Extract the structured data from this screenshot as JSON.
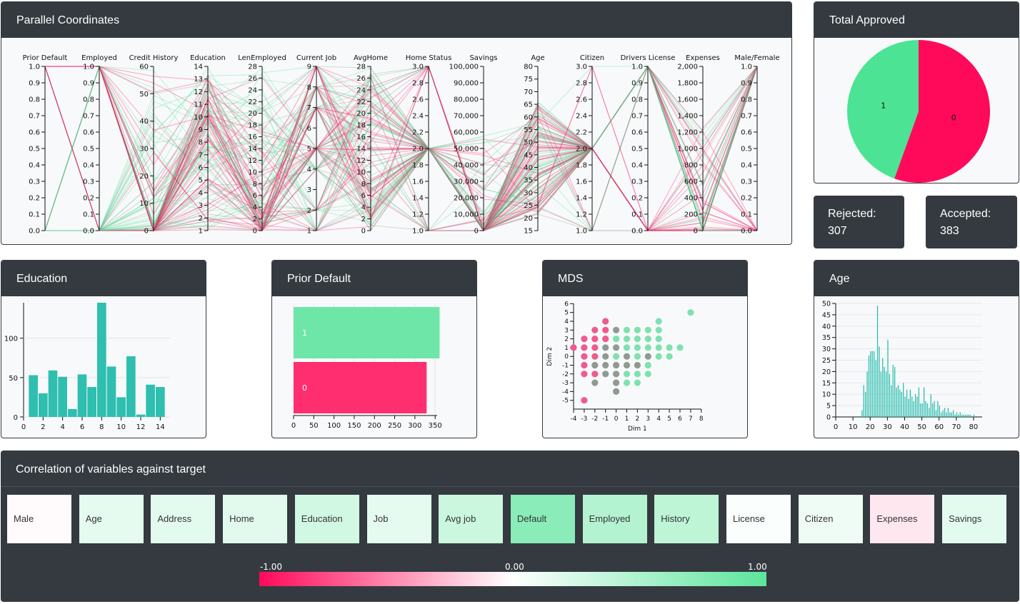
{
  "panels": {
    "parallel": "Parallel Coordinates",
    "approved": "Total Approved",
    "education": "Education",
    "prior_default": "Prior Default",
    "mds": "MDS",
    "age": "Age",
    "correlation": "Correlation of variables against target"
  },
  "stats": {
    "rejected_label": "Rejected:",
    "rejected_value": "307",
    "accepted_label": "Accepted:",
    "accepted_value": "383"
  },
  "colors": {
    "accepted": "#4ce394",
    "rejected": "#ff0a5a",
    "hist": "#2ebfb0",
    "dark": "#343a40"
  },
  "parallel_axes": [
    {
      "name": "Prior Default",
      "ticks": [
        "1.0",
        "0.9",
        "0.8",
        "0.7",
        "0.6",
        "0.5",
        "0.4",
        "0.3",
        "0.2",
        "0.1",
        "0.0"
      ]
    },
    {
      "name": "Employed",
      "ticks": [
        "1.0",
        "0.9",
        "0.8",
        "0.7",
        "0.6",
        "0.5",
        "0.4",
        "0.3",
        "0.2",
        "0.1",
        "0.0"
      ]
    },
    {
      "name": "Credit History",
      "ticks": [
        "60",
        "50",
        "40",
        "30",
        "20",
        "10",
        "0"
      ]
    },
    {
      "name": "Education",
      "ticks": [
        "14",
        "13",
        "12",
        "11",
        "10",
        "9",
        "8",
        "7",
        "6",
        "5",
        "4",
        "3",
        "2",
        "1"
      ]
    },
    {
      "name": "LenEmployed",
      "ticks": [
        "28",
        "26",
        "24",
        "22",
        "20",
        "18",
        "16",
        "14",
        "12",
        "10",
        "8",
        "6",
        "4",
        "2",
        "0"
      ]
    },
    {
      "name": "Current Job",
      "ticks": [
        "9",
        "8",
        "7",
        "6",
        "5",
        "4",
        "3",
        "2",
        "1"
      ]
    },
    {
      "name": "AvgHome",
      "ticks": [
        "28",
        "26",
        "24",
        "22",
        "20",
        "18",
        "16",
        "14",
        "12",
        "10",
        "8",
        "6",
        "4",
        "2",
        "0"
      ]
    },
    {
      "name": "Home Status",
      "ticks": [
        "3.0",
        "2.8",
        "2.6",
        "2.4",
        "2.2",
        "2.0",
        "1.8",
        "1.6",
        "1.4",
        "1.2",
        "1.0"
      ]
    },
    {
      "name": "Savings",
      "ticks": [
        "100,000",
        "90,000",
        "80,000",
        "70,000",
        "60,000",
        "50,000",
        "40,000",
        "30,000",
        "20,000",
        "10,000",
        "0"
      ]
    },
    {
      "name": "Age",
      "ticks": [
        "80",
        "75",
        "70",
        "65",
        "60",
        "55",
        "50",
        "45",
        "40",
        "35",
        "30",
        "25",
        "20",
        "15"
      ]
    },
    {
      "name": "Citizen",
      "ticks": [
        "3.0",
        "2.8",
        "2.6",
        "2.4",
        "2.2",
        "2.0",
        "1.8",
        "1.6",
        "1.4",
        "1.2",
        "1.0"
      ]
    },
    {
      "name": "Drivers License",
      "ticks": [
        "1.0",
        "0.9",
        "0.8",
        "0.7",
        "0.6",
        "0.5",
        "0.4",
        "0.3",
        "0.2",
        "0.1",
        "0.0"
      ]
    },
    {
      "name": "Expenses",
      "ticks": [
        "2,000",
        "1,800",
        "1,600",
        "1,400",
        "1,200",
        "1,000",
        "800",
        "600",
        "400",
        "200",
        "0"
      ]
    },
    {
      "name": "Male/Female",
      "ticks": [
        "1.0",
        "0.9",
        "0.8",
        "0.7",
        "0.6",
        "0.5",
        "0.4",
        "0.3",
        "0.2",
        "0.1",
        "0.0"
      ]
    }
  ],
  "correlation": {
    "cells": [
      {
        "label": "Male",
        "value": -0.02
      },
      {
        "label": "Age",
        "value": 0.16
      },
      {
        "label": "Address",
        "value": 0.17
      },
      {
        "label": "Home",
        "value": 0.18
      },
      {
        "label": "Education",
        "value": 0.28
      },
      {
        "label": "Job",
        "value": 0.16
      },
      {
        "label": "Avg job",
        "value": 0.32
      },
      {
        "label": "Default",
        "value": 0.72
      },
      {
        "label": "Employed",
        "value": 0.46
      },
      {
        "label": "History",
        "value": 0.4
      },
      {
        "label": "License",
        "value": 0.03
      },
      {
        "label": "Citizen",
        "value": 0.1
      },
      {
        "label": "Expenses",
        "value": -0.1
      },
      {
        "label": "Savings",
        "value": 0.17
      }
    ],
    "legend_min": "-1.00",
    "legend_mid": "0.00",
    "legend_max": "1.00"
  },
  "chart_data": [
    {
      "type": "pie",
      "title": "Total Approved",
      "slices": [
        {
          "label": "0",
          "value": 383,
          "color": "#ff0a5a"
        },
        {
          "label": "1",
          "value": 307,
          "color": "#4ce394"
        }
      ]
    },
    {
      "type": "bar",
      "title": "Education",
      "x": [
        1,
        2,
        3,
        4,
        5,
        6,
        7,
        8,
        9,
        10,
        11,
        12,
        13,
        14
      ],
      "values": [
        53,
        30,
        59,
        51,
        10,
        54,
        38,
        145,
        64,
        25,
        77,
        3,
        41,
        38
      ],
      "xticks": [
        "0",
        "2",
        "4",
        "6",
        "8",
        "10",
        "12",
        "14"
      ],
      "yticks": [
        "0",
        "50",
        "100"
      ],
      "xlim": [
        0,
        15
      ],
      "ylim": [
        0,
        145
      ]
    },
    {
      "type": "bar",
      "orientation": "horizontal",
      "title": "Prior Default",
      "categories": [
        "1",
        "0"
      ],
      "values": [
        361,
        329
      ],
      "xticks": [
        "0",
        "50",
        "100",
        "150",
        "200",
        "250",
        "300",
        "350"
      ],
      "xlim": [
        0,
        355
      ]
    },
    {
      "type": "scatter",
      "title": "MDS",
      "xlabel": "Dim 1",
      "ylabel": "Dim 2",
      "xticks": [
        "-4",
        "-3",
        "-2",
        "-1",
        "0",
        "1",
        "2",
        "3",
        "4",
        "5",
        "6",
        "7",
        "8"
      ],
      "yticks": [
        "-5",
        "-4",
        "-3",
        "-2",
        "-1",
        "0",
        "1",
        "2",
        "3",
        "4",
        "5",
        "6"
      ],
      "xlim": [
        -4,
        8
      ],
      "ylim": [
        -6,
        6
      ],
      "points": [
        {
          "x": -4,
          "y": 1,
          "c": "r"
        },
        {
          "x": -3,
          "y": -5,
          "c": "r"
        },
        {
          "x": -3,
          "y": 2,
          "c": "r"
        },
        {
          "x": -3,
          "y": 1,
          "c": "r"
        },
        {
          "x": -3,
          "y": 0,
          "c": "r"
        },
        {
          "x": -3,
          "y": -1,
          "c": "r"
        },
        {
          "x": -3,
          "y": -2,
          "c": "r"
        },
        {
          "x": -2,
          "y": 3,
          "c": "r"
        },
        {
          "x": -2,
          "y": 2,
          "c": "r"
        },
        {
          "x": -2,
          "y": 1,
          "c": "r"
        },
        {
          "x": -2,
          "y": 0,
          "c": "r"
        },
        {
          "x": -2,
          "y": -1,
          "c": "g"
        },
        {
          "x": -2,
          "y": -2,
          "c": "r"
        },
        {
          "x": -2,
          "y": -3,
          "c": "g"
        },
        {
          "x": -1,
          "y": 4,
          "c": "r"
        },
        {
          "x": -1,
          "y": 3,
          "c": "r"
        },
        {
          "x": -1,
          "y": 2,
          "c": "r"
        },
        {
          "x": -1,
          "y": 1,
          "c": "g"
        },
        {
          "x": -1,
          "y": 0,
          "c": "g"
        },
        {
          "x": -1,
          "y": -1,
          "c": "g"
        },
        {
          "x": -1,
          "y": -2,
          "c": "g"
        },
        {
          "x": 0,
          "y": 3,
          "c": "g"
        },
        {
          "x": 0,
          "y": 2,
          "c": "a"
        },
        {
          "x": 0,
          "y": 1,
          "c": "g"
        },
        {
          "x": 0,
          "y": 0,
          "c": "a"
        },
        {
          "x": 0,
          "y": -1,
          "c": "g"
        },
        {
          "x": 0,
          "y": -2,
          "c": "g"
        },
        {
          "x": 0,
          "y": -3,
          "c": "g"
        },
        {
          "x": 0,
          "y": -4,
          "c": "g"
        },
        {
          "x": 1,
          "y": 3,
          "c": "a"
        },
        {
          "x": 1,
          "y": 2,
          "c": "a"
        },
        {
          "x": 1,
          "y": 1,
          "c": "a"
        },
        {
          "x": 1,
          "y": 0,
          "c": "g"
        },
        {
          "x": 1,
          "y": -1,
          "c": "g"
        },
        {
          "x": 1,
          "y": -2,
          "c": "a"
        },
        {
          "x": 1,
          "y": -3,
          "c": "a"
        },
        {
          "x": 2,
          "y": 3,
          "c": "a"
        },
        {
          "x": 2,
          "y": 2,
          "c": "a"
        },
        {
          "x": 2,
          "y": 1,
          "c": "a"
        },
        {
          "x": 2,
          "y": 0,
          "c": "a"
        },
        {
          "x": 2,
          "y": -1,
          "c": "g"
        },
        {
          "x": 2,
          "y": -2,
          "c": "a"
        },
        {
          "x": 2,
          "y": -3,
          "c": "a"
        },
        {
          "x": 3,
          "y": 3,
          "c": "a"
        },
        {
          "x": 3,
          "y": 2,
          "c": "a"
        },
        {
          "x": 3,
          "y": 1,
          "c": "a"
        },
        {
          "x": 3,
          "y": 0,
          "c": "g"
        },
        {
          "x": 3,
          "y": -1,
          "c": "a"
        },
        {
          "x": 3,
          "y": -2,
          "c": "a"
        },
        {
          "x": 4,
          "y": 4,
          "c": "a"
        },
        {
          "x": 4,
          "y": 3,
          "c": "a"
        },
        {
          "x": 4,
          "y": 2,
          "c": "a"
        },
        {
          "x": 4,
          "y": 1,
          "c": "a"
        },
        {
          "x": 4,
          "y": 0,
          "c": "a"
        },
        {
          "x": 5,
          "y": 1,
          "c": "a"
        },
        {
          "x": 5,
          "y": 0,
          "c": "a"
        },
        {
          "x": 6,
          "y": 1,
          "c": "a"
        },
        {
          "x": 7,
          "y": 5,
          "c": "a"
        }
      ]
    },
    {
      "type": "bar",
      "title": "Age",
      "xticks": [
        "0",
        "10",
        "20",
        "30",
        "40",
        "50",
        "60",
        "70",
        "80"
      ],
      "yticks": [
        "0",
        "5",
        "10",
        "15",
        "20",
        "25",
        "30",
        "35",
        "40",
        "45",
        "50"
      ],
      "xlim": [
        0,
        85
      ],
      "ylim": [
        0,
        50
      ],
      "bins": [
        [
          15,
          3
        ],
        [
          16,
          14
        ],
        [
          17,
          11
        ],
        [
          18,
          20
        ],
        [
          19,
          27
        ],
        [
          20,
          29
        ],
        [
          21,
          29
        ],
        [
          22,
          29
        ],
        [
          23,
          25
        ],
        [
          24,
          49
        ],
        [
          25,
          31
        ],
        [
          26,
          20
        ],
        [
          27,
          26
        ],
        [
          28,
          22
        ],
        [
          29,
          20
        ],
        [
          30,
          34
        ],
        [
          31,
          19
        ],
        [
          32,
          14
        ],
        [
          33,
          23
        ],
        [
          34,
          22
        ],
        [
          35,
          13
        ],
        [
          36,
          14
        ],
        [
          37,
          12
        ],
        [
          38,
          11
        ],
        [
          39,
          15
        ],
        [
          40,
          9
        ],
        [
          41,
          12
        ],
        [
          42,
          8
        ],
        [
          43,
          12
        ],
        [
          44,
          9
        ],
        [
          45,
          7
        ],
        [
          46,
          10
        ],
        [
          47,
          9
        ],
        [
          48,
          13
        ],
        [
          49,
          6
        ],
        [
          50,
          6
        ],
        [
          51,
          13
        ],
        [
          52,
          7
        ],
        [
          53,
          6
        ],
        [
          54,
          4
        ],
        [
          55,
          10
        ],
        [
          56,
          6
        ],
        [
          57,
          7
        ],
        [
          58,
          3
        ],
        [
          59,
          7
        ],
        [
          60,
          5
        ],
        [
          61,
          2
        ],
        [
          62,
          3
        ],
        [
          63,
          4
        ],
        [
          64,
          2
        ],
        [
          65,
          4
        ],
        [
          66,
          2
        ],
        [
          67,
          2
        ],
        [
          68,
          3
        ],
        [
          69,
          1
        ],
        [
          70,
          2
        ],
        [
          71,
          1
        ],
        [
          72,
          2
        ],
        [
          73,
          1
        ],
        [
          74,
          1
        ],
        [
          75,
          1
        ],
        [
          76,
          1
        ],
        [
          77,
          1
        ],
        [
          78,
          1
        ],
        [
          80,
          1
        ]
      ]
    }
  ]
}
